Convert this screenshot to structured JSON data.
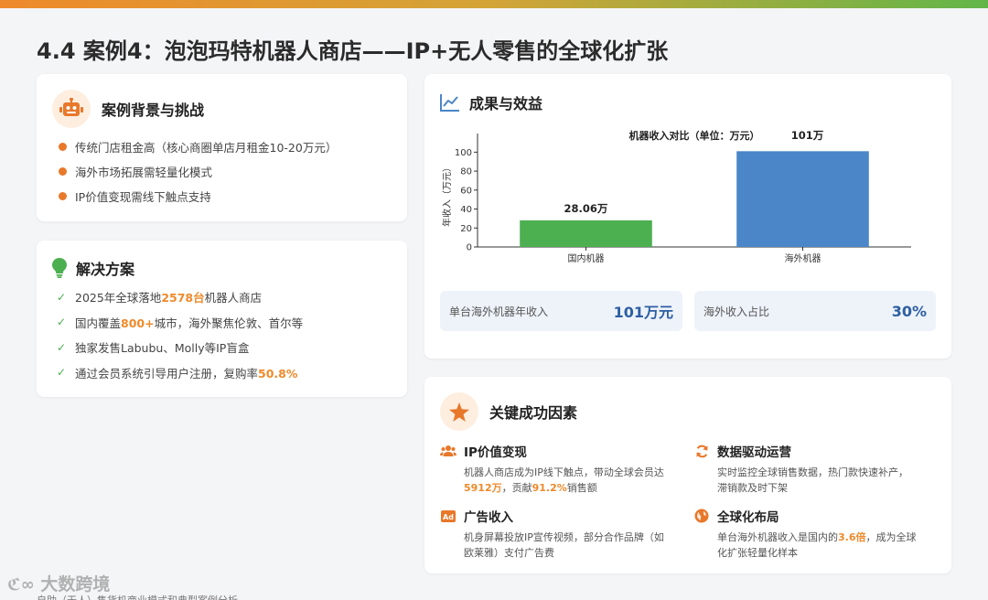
{
  "page": {
    "title": "4.4 案例4：泡泡玛特机器人商店——IP+无人零售的全球化扩张",
    "watermark": "大数跨境",
    "footnote": "自助（无人）售货机商业模式和典型案例分析"
  },
  "background": {
    "title": "案例背景与挑战",
    "icon": "robot-icon",
    "items": [
      "传统门店租金高（核心商圈单店月租金10-20万元）",
      "海外市场拓展需轻量化模式",
      "IP价值变现需线下触点支持"
    ]
  },
  "solution": {
    "title": "解决方案",
    "icon": "lightbulb-icon",
    "items": [
      {
        "pre": "2025年全球落地",
        "hl": "2578台",
        "post": "机器人商店"
      },
      {
        "pre": "国内覆盖",
        "hl": "800+",
        "post": "城市，海外聚焦伦敦、首尔等"
      },
      {
        "pre": "独家发售Labubu、Molly等IP盲盒",
        "hl": "",
        "post": ""
      },
      {
        "pre": "通过会员系统引导用户注册，复购率",
        "hl": "50.8%",
        "post": ""
      }
    ]
  },
  "results": {
    "title": "成果与效益",
    "icon": "line-chart-icon",
    "stats": [
      {
        "label": "单台海外机器年收入",
        "value": "101万元"
      },
      {
        "label": "海外收入占比",
        "value": "30%"
      }
    ]
  },
  "chart_data": {
    "type": "bar",
    "title": "机器收入对比（单位：万元）",
    "ylabel": "年收入（万元）",
    "categories": [
      "国内机器",
      "海外机器"
    ],
    "values": [
      28.06,
      101
    ],
    "data_labels": [
      "28.06万",
      "101万"
    ],
    "colors": [
      "#4caf50",
      "#4a86c8"
    ],
    "ylim": [
      0,
      110
    ],
    "yticks": [
      0,
      20,
      40,
      60,
      80,
      100
    ],
    "grid": false
  },
  "factors": {
    "title": "关键成功因素",
    "icon": "star-icon",
    "items": [
      {
        "title": "IP价值变现",
        "icon": "users-icon",
        "segments": [
          {
            "t": "机器人商店成为IP线下触点，带动全球会员达",
            "h": false
          },
          {
            "t": "5912万",
            "h": true
          },
          {
            "t": "，贡献",
            "h": false
          },
          {
            "t": "91.2%",
            "h": true
          },
          {
            "t": "销售额",
            "h": false
          }
        ]
      },
      {
        "title": "数据驱动运营",
        "icon": "sync-icon",
        "segments": [
          {
            "t": "实时监控全球销售数据，热门款快速补产，滞销款及时下架",
            "h": false
          }
        ]
      },
      {
        "title": "广告收入",
        "icon": "ad-icon",
        "segments": [
          {
            "t": "机身屏幕投放IP宣传视频，部分合作品牌（如欧莱雅）支付广告费",
            "h": false
          }
        ]
      },
      {
        "title": "全球化布局",
        "icon": "globe-icon",
        "segments": [
          {
            "t": "单台海外机器收入是国内的",
            "h": false
          },
          {
            "t": "3.6倍",
            "h": true
          },
          {
            "t": "，成为全球化扩张轻量化样本",
            "h": false
          }
        ]
      }
    ]
  },
  "colors": {
    "accent": "#ee8a2b",
    "green": "#4caf50",
    "blue": "#4a86c8",
    "stat_value": "#2e5fa3"
  }
}
